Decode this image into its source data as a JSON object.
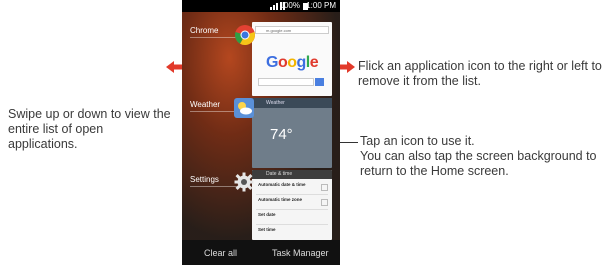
{
  "phone": {
    "status_bar": {
      "battery": "100%",
      "time": "1:00 PM"
    },
    "apps": [
      {
        "label": "Chrome"
      },
      {
        "label": "Weather"
      },
      {
        "label": "Settings"
      }
    ],
    "chrome_card": {
      "url": "m.google.com",
      "google_logo": "Google"
    },
    "weather_card": {
      "header": "Weather",
      "temperature": "74°"
    },
    "settings_card": {
      "header": "Date & time",
      "rows": [
        {
          "title": "Automatic date & time"
        },
        {
          "title": "Automatic time zone"
        },
        {
          "title": "Set date"
        },
        {
          "title": "Set time"
        }
      ]
    },
    "bottom_bar": {
      "clear_all": "Clear all",
      "task_manager": "Task Manager"
    }
  },
  "callouts": {
    "flick": "Flick an application icon to the right or left to remove it from the list.",
    "swipe": "Swipe up or down to view the entire list of open applications.",
    "tap": "Tap an icon to use it.\nYou can also tap the screen background to return to the Home screen."
  },
  "colors": {
    "arrow": "#e23a2a",
    "google_blue": "#4a7fe0"
  }
}
